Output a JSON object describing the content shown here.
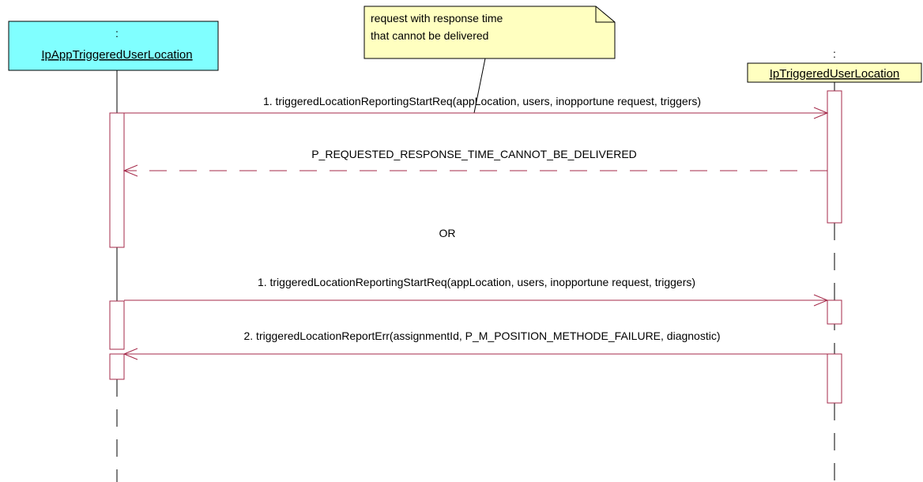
{
  "participants": {
    "app": {
      "colon": ":",
      "name": "IpAppTriggeredUserLocation",
      "fill": "#80ffff"
    },
    "tul": {
      "colon": ":",
      "name": "IpTriggeredUserLocation",
      "fill": "#ffffc0"
    }
  },
  "note": {
    "line1": "request with response time",
    "line2": "that cannot be delivered",
    "fill": "#ffffc0"
  },
  "messages": {
    "m1": "1. triggeredLocationReportingStartReq(appLocation, users, inopportune request, triggers)",
    "m2": "P_REQUESTED_RESPONSE_TIME_CANNOT_BE_DELIVERED",
    "or": "OR",
    "m3": "1. triggeredLocationReportingStartReq(appLocation, users, inopportune request, triggers)",
    "m4": "2. triggeredLocationReportErr(assignmentId, P_M_POSITION_METHODE_FAILURE, diagnostic)"
  },
  "colors": {
    "message_line": "#a52a4a",
    "outline": "#000000"
  }
}
